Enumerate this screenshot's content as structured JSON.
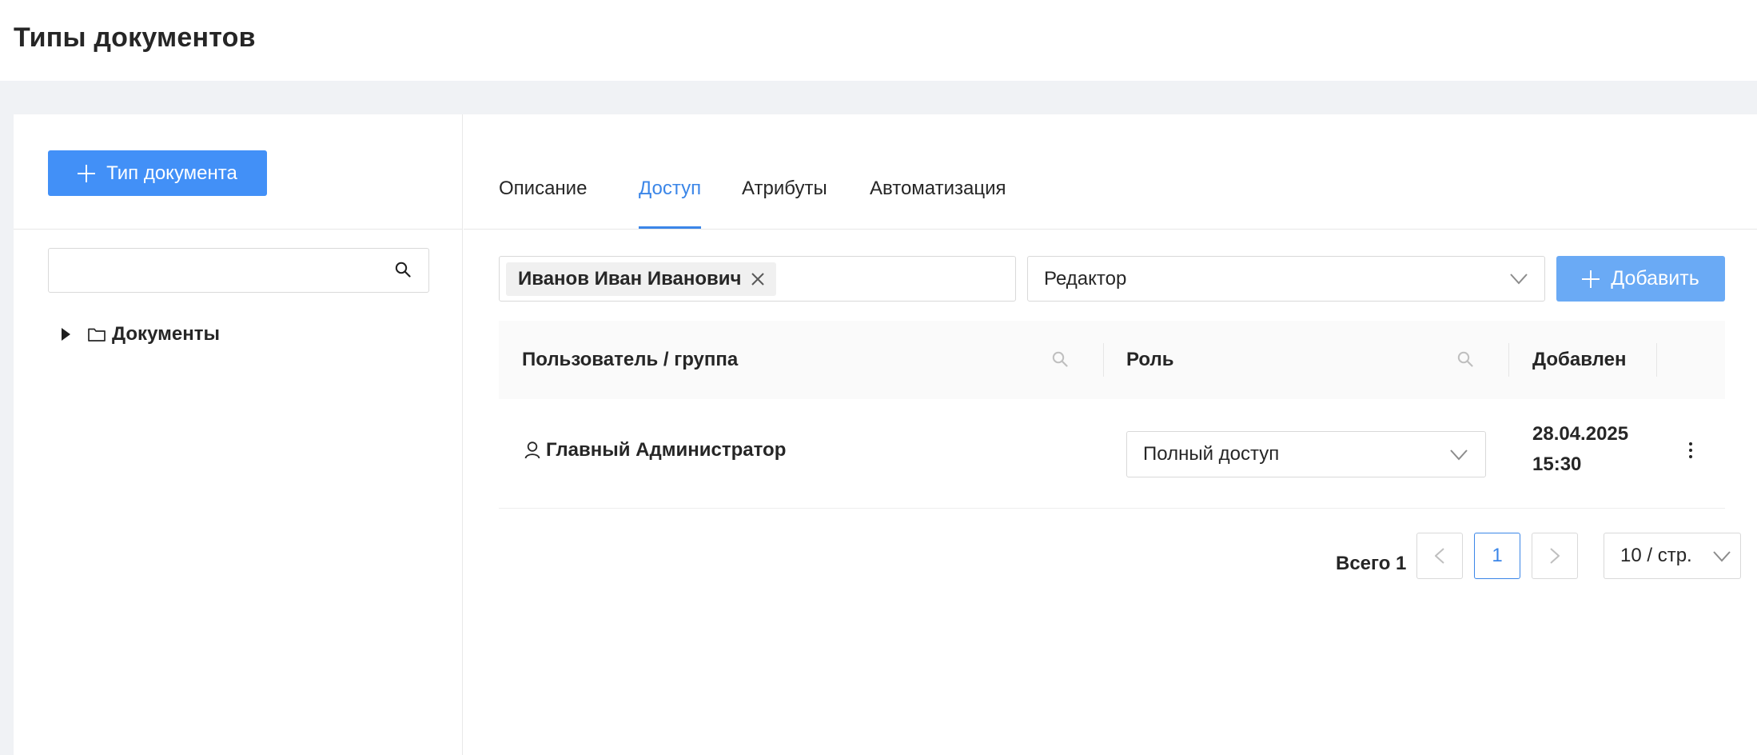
{
  "page": {
    "title": "Типы документов"
  },
  "left_panel": {
    "add_button_label": "Тип документа",
    "search": {
      "value": "",
      "placeholder": ""
    },
    "tree": [
      {
        "label": "Документы",
        "icon": "folder-icon",
        "expanded": false
      }
    ]
  },
  "tabs": [
    {
      "label": "Описание",
      "active": false
    },
    {
      "label": "Доступ",
      "active": true
    },
    {
      "label": "Атрибуты",
      "active": false
    },
    {
      "label": "Автоматизация",
      "active": false
    }
  ],
  "access_form": {
    "selected_user_tag": "Иванов Иван Иванович",
    "role_select_value": "Редактор",
    "add_button_label": "Добавить"
  },
  "table": {
    "columns": [
      "Пользователь / группа",
      "Роль",
      "Добавлен"
    ],
    "rows": [
      {
        "user": "Главный Администратор",
        "role": "Полный доступ",
        "added_date": "28.04.2025",
        "added_time": "15:30"
      }
    ]
  },
  "pagination": {
    "total_label": "Всего 1",
    "current_page": "1",
    "page_size_label": "10 / стр."
  },
  "colors": {
    "accent": "#3b86e8",
    "primary_button": "#4290f7",
    "disabled_primary_button": "#6aaaf5"
  }
}
